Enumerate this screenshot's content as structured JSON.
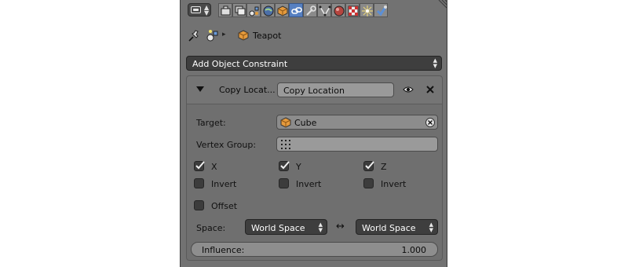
{
  "context": {
    "object_name": "Teapot"
  },
  "add_constraint": {
    "label": "Add Object Constraint"
  },
  "constraint": {
    "title_short": "Copy Locat...",
    "name_value": "Copy Location",
    "target_label": "Target:",
    "target_value": "Cube",
    "vertex_group_label": "Vertex Group:",
    "axes": [
      {
        "label": "X",
        "checked": true
      },
      {
        "label": "Y",
        "checked": true
      },
      {
        "label": "Z",
        "checked": true
      }
    ],
    "invert_label": "Invert",
    "offset_label": "Offset",
    "space_label": "Space:",
    "owner_space": "World Space",
    "target_space": "World Space",
    "swap_symbol": "↔",
    "influence_label": "Influence:",
    "influence_value": "1.000"
  },
  "icons": {
    "tabs": [
      "render-icon",
      "render-layers-icon",
      "scene-icon",
      "world-icon",
      "object-icon",
      "constraints-icon",
      "modifiers-icon",
      "data-icon",
      "material-icon",
      "texture-icon",
      "particles-icon",
      "physics-icon"
    ],
    "active_tab": "constraints-icon"
  },
  "colors": {
    "panel_bg": "#727272",
    "active_tab": "#5680c2",
    "dropdown_bg": "#3e3e3e",
    "field_bg": "#9a9a9a"
  }
}
